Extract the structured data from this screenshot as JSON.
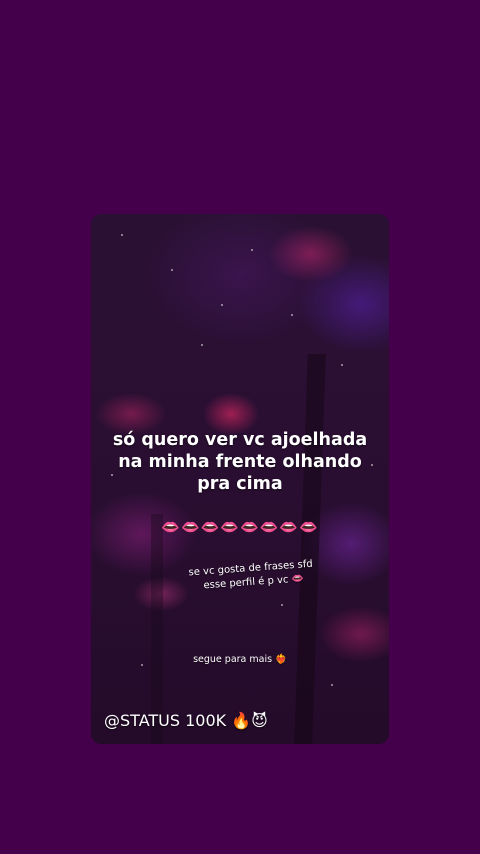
{
  "post": {
    "main_text_line1": "só quero ver vc ajoelhada",
    "main_text_line2": "na minha frente olhando",
    "main_text_line3": "pra cima",
    "lips_emojis": "👄👄👄👄👄👄👄👄",
    "caption_line1": "se vc gosta de frases sfd",
    "caption_line2": "esse perfil é p vc 👄",
    "follow_text": "segue para mais ❤️‍🔥",
    "watermark": "@STATUS 100K 🔥😈"
  },
  "colors": {
    "background": "#44004a",
    "text": "#ffffff"
  }
}
